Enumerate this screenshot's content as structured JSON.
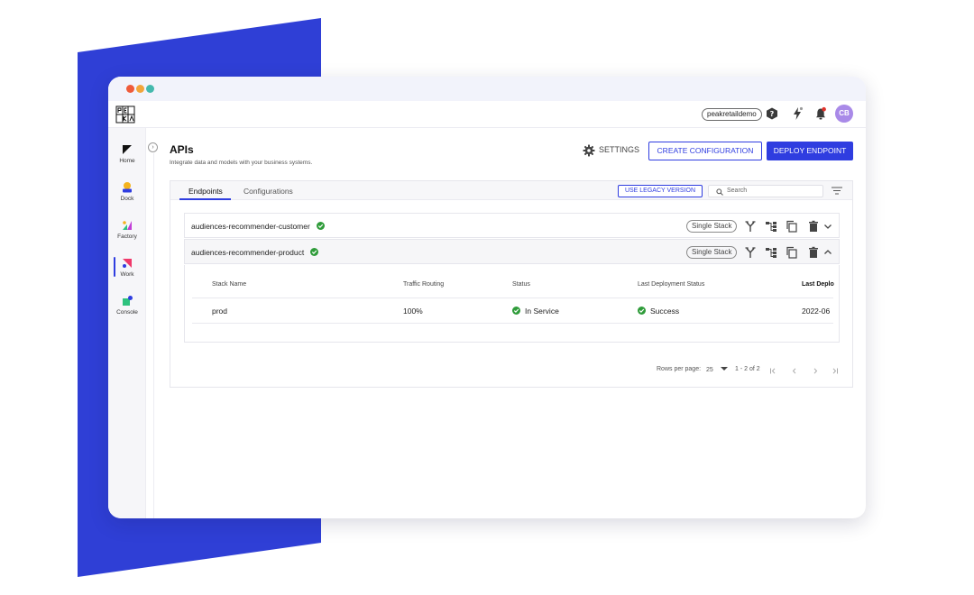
{
  "brand": {
    "accent": "#2f3de0",
    "backdrop": "#2f3fd6",
    "avatar_color": "#a98ae8"
  },
  "topbar": {
    "logo_icon": "peak-logo-icon",
    "tenant": "peakretaildemo",
    "icons": [
      "help-icon",
      "lightning-icon",
      "bell-icon"
    ],
    "avatar": "CB"
  },
  "sidebar": {
    "items": [
      {
        "label": "Home",
        "icon": "home-icon"
      },
      {
        "label": "Dock",
        "icon": "dock-icon"
      },
      {
        "label": "Factory",
        "icon": "factory-icon"
      },
      {
        "label": "Work",
        "icon": "work-icon",
        "active": true
      },
      {
        "label": "Console",
        "icon": "console-icon"
      }
    ]
  },
  "page": {
    "title": "APIs",
    "subtitle": "Integrate data and models with your business systems.",
    "settings_label": "SETTINGS",
    "create_label": "CREATE CONFIGURATION",
    "deploy_label": "DEPLOY ENDPOINT"
  },
  "tabs": [
    {
      "label": "Endpoints",
      "active": true
    },
    {
      "label": "Configurations",
      "active": false
    }
  ],
  "toolbar": {
    "legacy_label": "USE LEGACY VERSION",
    "search_placeholder": "Search"
  },
  "endpoints": [
    {
      "name": "audiences-recommender-customer",
      "stack_type": "Single Stack",
      "expanded": false
    },
    {
      "name": "audiences-recommender-product",
      "stack_type": "Single Stack",
      "expanded": true
    }
  ],
  "stack_table": {
    "columns": [
      "Stack Name",
      "Traffic Routing",
      "Status",
      "Last Deployment Status",
      "Last Deplo"
    ],
    "rows": [
      {
        "stack_name": "prod",
        "traffic": "100%",
        "status": "In Service",
        "last_status": "Success",
        "last_date": "2022-06"
      }
    ]
  },
  "pagination": {
    "rows_label": "Rows per page:",
    "rows_value": "25",
    "range": "1 - 2 of 2"
  }
}
